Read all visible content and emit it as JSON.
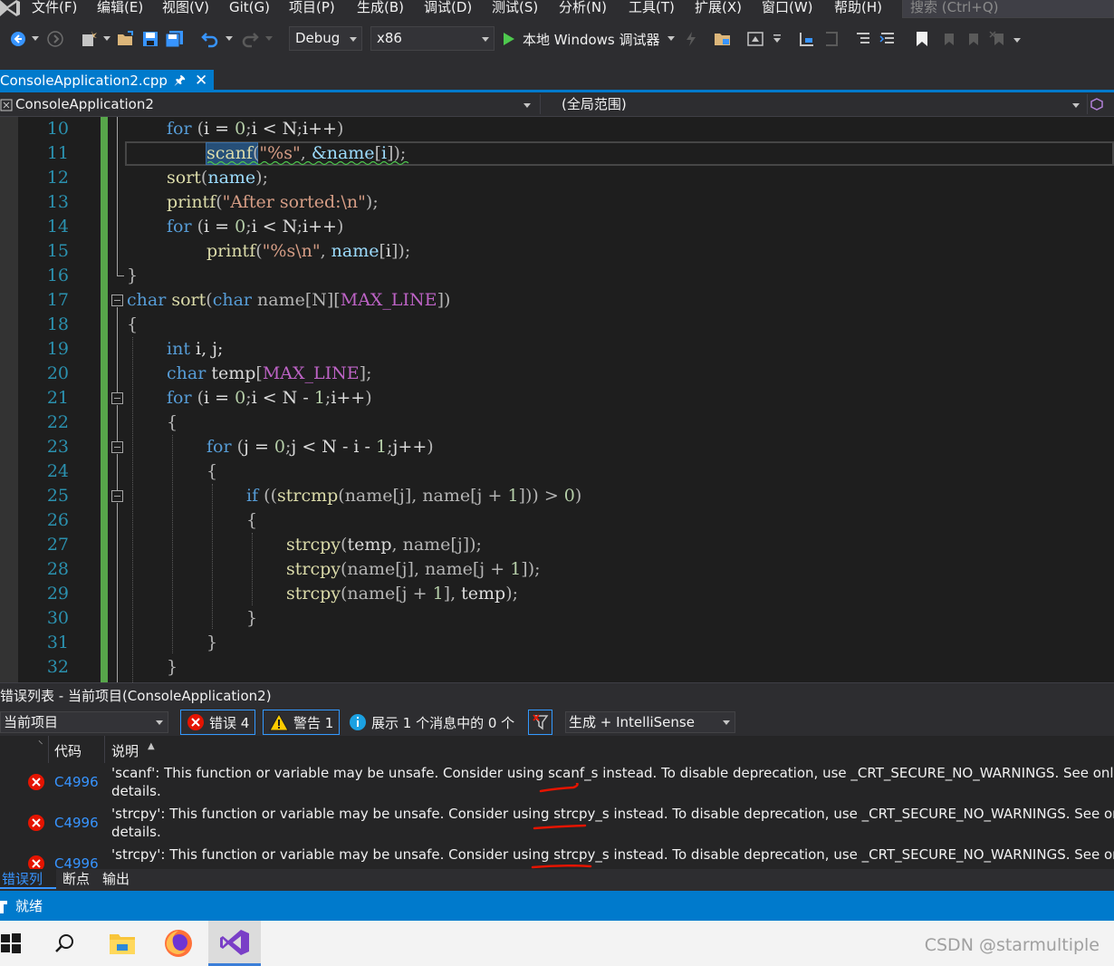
{
  "menubar": {
    "items": [
      "文件(F)",
      "编辑(E)",
      "视图(V)",
      "Git(G)",
      "项目(P)",
      "生成(B)",
      "调试(D)",
      "测试(S)",
      "分析(N)",
      "工具(T)",
      "扩展(X)",
      "窗口(W)",
      "帮助(H)"
    ],
    "search_placeholder": "搜索 (Ctrl+Q)"
  },
  "toolbar": {
    "configuration": "Debug",
    "platform": "x86",
    "start_label": "本地 Windows 调试器"
  },
  "document_tab": {
    "filename": "ConsoleApplication2.cpp"
  },
  "navbar": {
    "project": "ConsoleApplication2",
    "scope": "(全局范围)"
  },
  "editor": {
    "line_numbers": [
      "10",
      "11",
      "12",
      "13",
      "14",
      "15",
      "16",
      "17",
      "18",
      "19",
      "20",
      "21",
      "22",
      "23",
      "24",
      "25",
      "26",
      "27",
      "28",
      "29",
      "30",
      "31",
      "32"
    ],
    "code": [
      "for (i = 0;i < N;i++)",
      "scanf(\"%s\", &name[i]);",
      "sort(name);",
      "printf(\"After sorted:\\n\");",
      "for (i = 0;i < N;i++)",
      "printf(\"%s\\n\", name[i]);",
      "}",
      "char sort(char name[N][MAX_LINE])",
      "{",
      "int i, j;",
      "char temp[MAX_LINE];",
      "for (i = 0;i < N - 1;i++)",
      "{",
      "for (j = 0;j < N - i - 1;j++)",
      "{",
      "if ((strcmp(name[j], name[j + 1])) > 0)",
      "{",
      "strcpy(temp, name[j]);",
      "strcpy(name[j], name[j + 1]);",
      "strcpy(name[j + 1], temp);",
      "}",
      "}",
      "}"
    ]
  },
  "error_list": {
    "title": "错误列表 - 当前项目(ConsoleApplication2)",
    "scope_combo": "当前项目",
    "errors_button": "错误 4",
    "warnings_button": "警告 1",
    "messages_button": "展示 1 个消息中的 0 个",
    "build_filter": "生成 + IntelliSense",
    "columns": {
      "code": "代码",
      "description": "说明"
    },
    "rows": [
      {
        "code": "C4996",
        "line1": "'scanf': This function or variable may be unsafe. Consider using scanf_s instead. To disable deprecation, use _CRT_SECURE_NO_WARNINGS. See online help for details.",
        "line2": "details."
      },
      {
        "code": "C4996",
        "line1": "'strcpy': This function or variable may be unsafe. Consider using strcpy_s instead. To disable deprecation, use _CRT_SECURE_NO_WARNINGS. See online help for details.",
        "line2": "details."
      },
      {
        "code": "C4996",
        "line1": "'strcpy': This function or variable may be unsafe. Consider using strcpy_s instead. To disable deprecation, use _CRT_SECURE_NO_WARNINGS. See online help for details.",
        "line2": ""
      }
    ]
  },
  "bottom_tabs": [
    "错误列表",
    "断点",
    "输出"
  ],
  "statusbar": {
    "text": "就绪"
  },
  "watermark": "CSDN @starmultiple",
  "colors": {
    "accent": "#007acc",
    "keyword": "#569cd6",
    "function": "#dcdcaa",
    "string": "#d69d85",
    "macro": "#bd63c5",
    "line_number": "#2b91af",
    "error_red": "#e51400",
    "change_bar": "#57a64a"
  }
}
